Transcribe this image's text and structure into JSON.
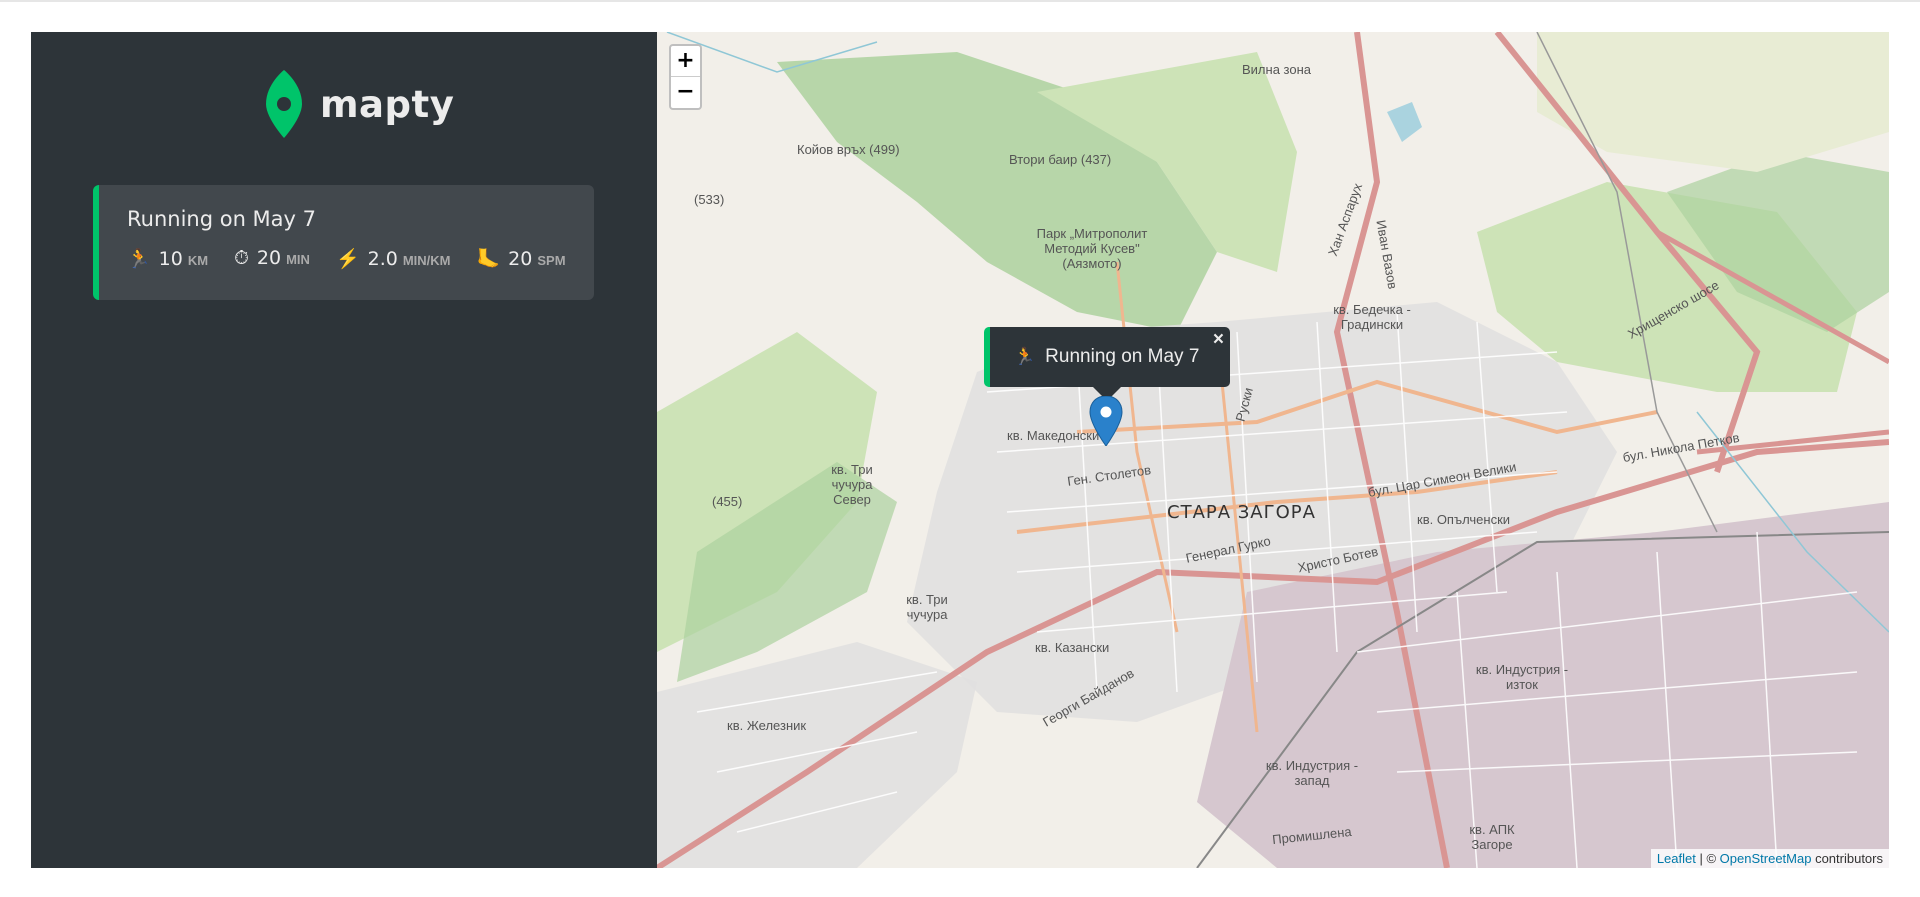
{
  "app": {
    "logo_text": "mapty"
  },
  "workouts": [
    {
      "title": "Running on May 7",
      "type": "running",
      "distance": {
        "icon": "🏃",
        "value": "10",
        "unit": "km"
      },
      "duration": {
        "icon": "⏱",
        "value": "20",
        "unit": "min"
      },
      "pace": {
        "icon": "⚡",
        "value": "2.0",
        "unit": "min/km"
      },
      "cadence": {
        "icon": "🦶",
        "value": "20",
        "unit": "spm"
      }
    }
  ],
  "map": {
    "zoom_in_label": "+",
    "zoom_out_label": "−",
    "popup": {
      "icon": "🏃",
      "text": "Running on May 7",
      "close": "×"
    },
    "attribution": {
      "leaflet": "Leaflet",
      "separator": " | © ",
      "osm": "OpenStreetMap",
      "suffix": " contributors"
    },
    "labels": {
      "city": "СТАРА ЗАГОРА",
      "l1": "Вилна зона",
      "l2": "Койов връх (499)",
      "l3": "Втори баир (437)",
      "l4": "(533)",
      "l5": "Парк „Митрополит Методий Кусев\" (Аязмото)",
      "l6": "кв. Бедечка - Градински",
      "l7": "кв. Македонски",
      "l8": "Ген. Столетов",
      "l9": "кв. Три чучура Север",
      "l10": "(455)",
      "l11": "Генерал Гурко",
      "l12": "Христо Ботев",
      "l13": "кв. Три чучура",
      "l14": "кв. Казански",
      "l15": "кв. Железник",
      "l16": "кв. Индустрия - изток",
      "l17": "кв. Индустрия - запад",
      "l18": "Промишлена",
      "l19": "кв. АПК Загоре",
      "l20": "бул. Никола Петков",
      "l21": "кв. Опълченски",
      "l22": "бул. Цар Симеон Велики",
      "l23": "Хрищенско шосе",
      "l24": "Иван Вазов",
      "l25": "Хан Аспарух",
      "l26": "Руски",
      "l27": "Георги Байданов"
    }
  },
  "colors": {
    "sidebar_bg": "#2d3439",
    "workout_bg": "#42484d",
    "running_accent": "#00c46a",
    "text": "#ececec",
    "marker": "#2a81cb"
  }
}
